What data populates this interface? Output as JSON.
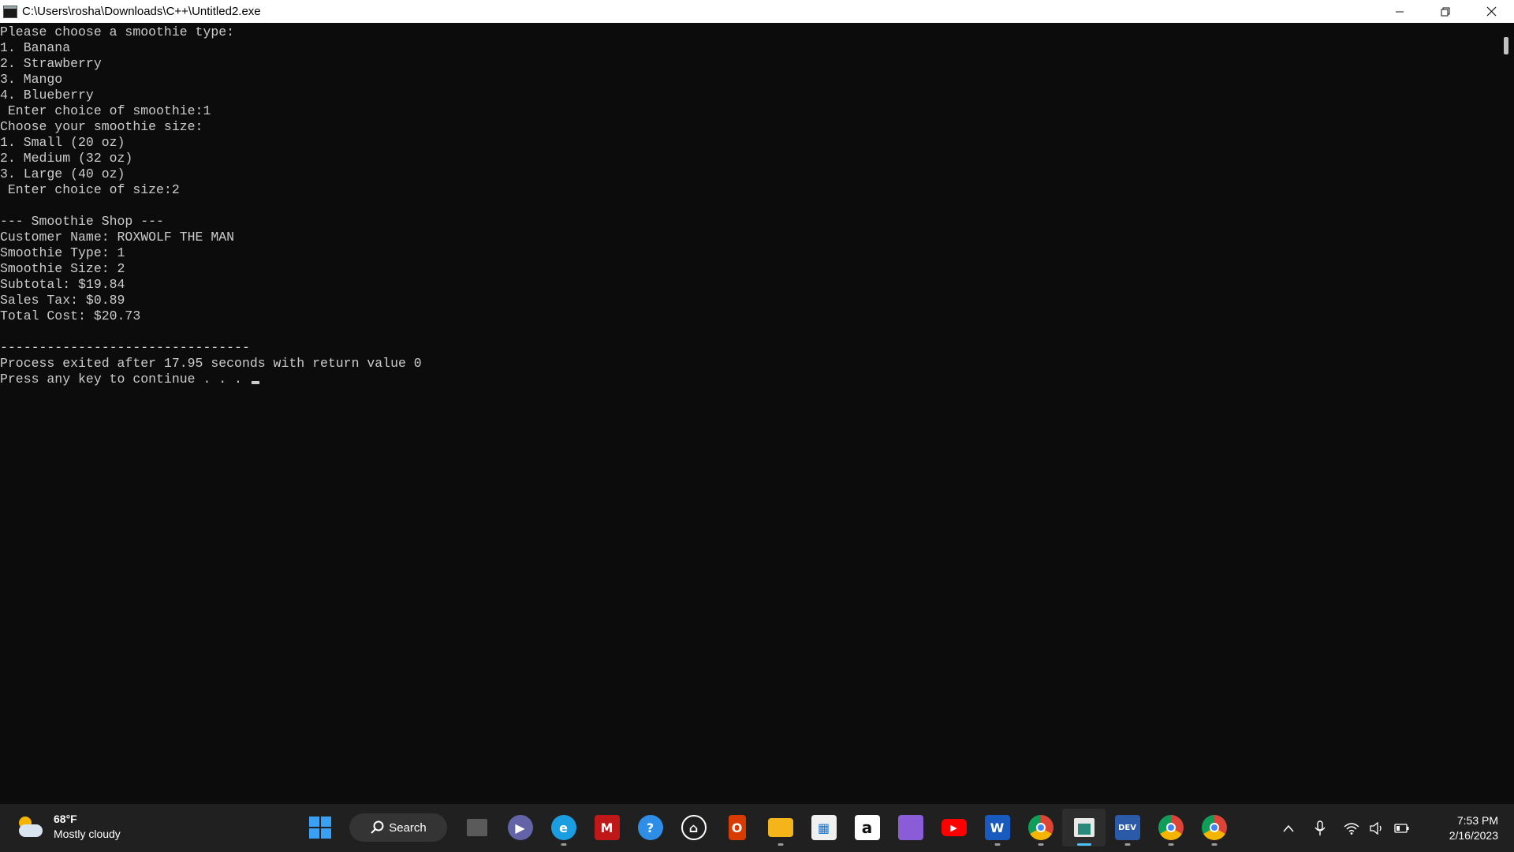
{
  "window": {
    "title": "C:\\Users\\rosha\\Downloads\\C++\\Untitled2.exe",
    "controls": [
      "minimize",
      "restore",
      "close"
    ]
  },
  "console": {
    "lines": [
      "Please choose a smoothie type:",
      "1. Banana",
      "2. Strawberry",
      "3. Mango",
      "4. Blueberry",
      " Enter choice of smoothie:1",
      "Choose your smoothie size:",
      "1. Small (20 oz)",
      "2. Medium (32 oz)",
      "3. Large (40 oz)",
      " Enter choice of size:2",
      "",
      "--- Smoothie Shop ---",
      "Customer Name: ROXWOLF THE MAN",
      "Smoothie Type: 1",
      "Smoothie Size: 2",
      "Subtotal: $19.84",
      "Sales Tax: $0.89",
      "Total Cost: $20.73",
      "",
      "--------------------------------",
      "Process exited after 17.95 seconds with return value 0",
      "Press any key to continue . . . "
    ]
  },
  "taskbar": {
    "weather": {
      "temp": "68°F",
      "condition": "Mostly cloudy"
    },
    "search_label": "Search",
    "apps": [
      {
        "name": "task-view",
        "icon": "task-view-icon"
      },
      {
        "name": "teams-chat",
        "icon": "chat-icon"
      },
      {
        "name": "edge",
        "icon": "edge-icon",
        "running": true
      },
      {
        "name": "mcafee",
        "icon": "mcafee-icon"
      },
      {
        "name": "get-help",
        "icon": "help-icon"
      },
      {
        "name": "tool",
        "icon": "tool-icon"
      },
      {
        "name": "office",
        "icon": "office-icon"
      },
      {
        "name": "file-explorer",
        "icon": "folder-icon",
        "running": true
      },
      {
        "name": "microsoft-store",
        "icon": "store-icon"
      },
      {
        "name": "amazon",
        "icon": "amazon-icon"
      },
      {
        "name": "clipchamp",
        "icon": "clipchamp-icon"
      },
      {
        "name": "youtube",
        "icon": "youtube-icon"
      },
      {
        "name": "word",
        "icon": "word-icon",
        "running": true
      },
      {
        "name": "chrome-1",
        "icon": "chrome-icon",
        "running": true
      },
      {
        "name": "console",
        "icon": "console-icon",
        "active": true
      },
      {
        "name": "dev-cpp",
        "icon": "devcpp-icon",
        "running": true
      },
      {
        "name": "chrome-2",
        "icon": "chrome-icon",
        "running": true
      },
      {
        "name": "chrome-3",
        "icon": "chrome-icon",
        "running": true
      }
    ],
    "clock": {
      "time": "7:53 PM",
      "date": "2/16/2023"
    },
    "colors": {
      "accent": "#4cc2ff",
      "taskbar_bg": "#202020",
      "console_bg": "#0c0c0c",
      "console_fg": "#cccccc"
    }
  }
}
